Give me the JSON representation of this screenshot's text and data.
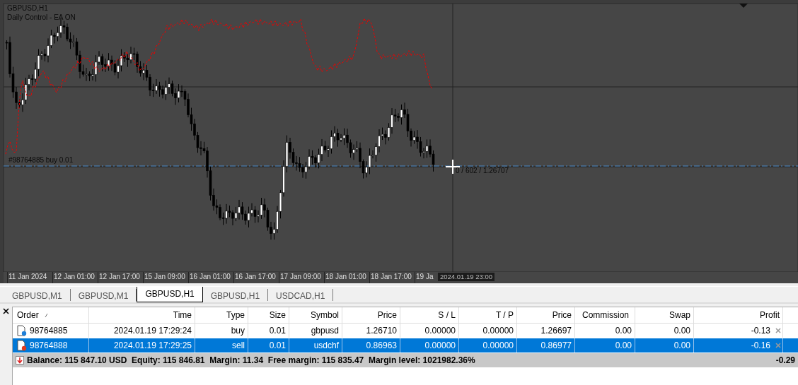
{
  "chart": {
    "title": "GBPUSD,H1",
    "indicator_label": "Daily Control - EA ON",
    "order_label": "#98764885 buy 0.01",
    "crosshair_readout": "0 / 602 / 1.26707",
    "time_labels": [
      "11 Jan 2024",
      "12 Jan 01:00",
      "12 Jan 17:00",
      "15 Jan 09:00",
      "16 Jan 01:00",
      "16 Jan 17:00",
      "17 Jan 09:00",
      "18 Jan 01:00",
      "18 Jan 17:00",
      "19 Ja"
    ],
    "cursor_time": "2024.01.19 23:00"
  },
  "tabs": [
    {
      "label": "GBPUSD,M1",
      "selected": false
    },
    {
      "label": "GBPUSD,M1",
      "selected": false
    },
    {
      "label": "GBPUSD,H1",
      "selected": true
    },
    {
      "label": "GBPUSD,H1",
      "selected": false
    },
    {
      "label": "USDCAD,H1",
      "selected": false
    }
  ],
  "terminal": {
    "columns": [
      "Order",
      "Time",
      "Type",
      "Size",
      "Symbol",
      "Price",
      "S / L",
      "T / P",
      "Price",
      "Commission",
      "Swap",
      "Profit"
    ],
    "rows": [
      {
        "kind": "buy",
        "selected": false,
        "cells": [
          "98764885",
          "2024.01.19 17:29:24",
          "buy",
          "0.01",
          "gbpusd",
          "1.26710",
          "0.00000",
          "0.00000",
          "1.26697",
          "0.00",
          "0.00",
          "-0.13"
        ]
      },
      {
        "kind": "sell",
        "selected": true,
        "cells": [
          "98764888",
          "2024.01.19 17:29:25",
          "sell",
          "0.01",
          "usdchf",
          "0.86963",
          "0.00000",
          "0.00000",
          "0.86977",
          "0.00",
          "0.00",
          "-0.16"
        ]
      }
    ],
    "summary": {
      "text": "Balance: 115 847.10 USD  Equity: 115 846.81  Margin: 11.34  Free margin: 115 835.47  Margin level: 1021982.36%",
      "profit": "-0.29"
    }
  }
}
